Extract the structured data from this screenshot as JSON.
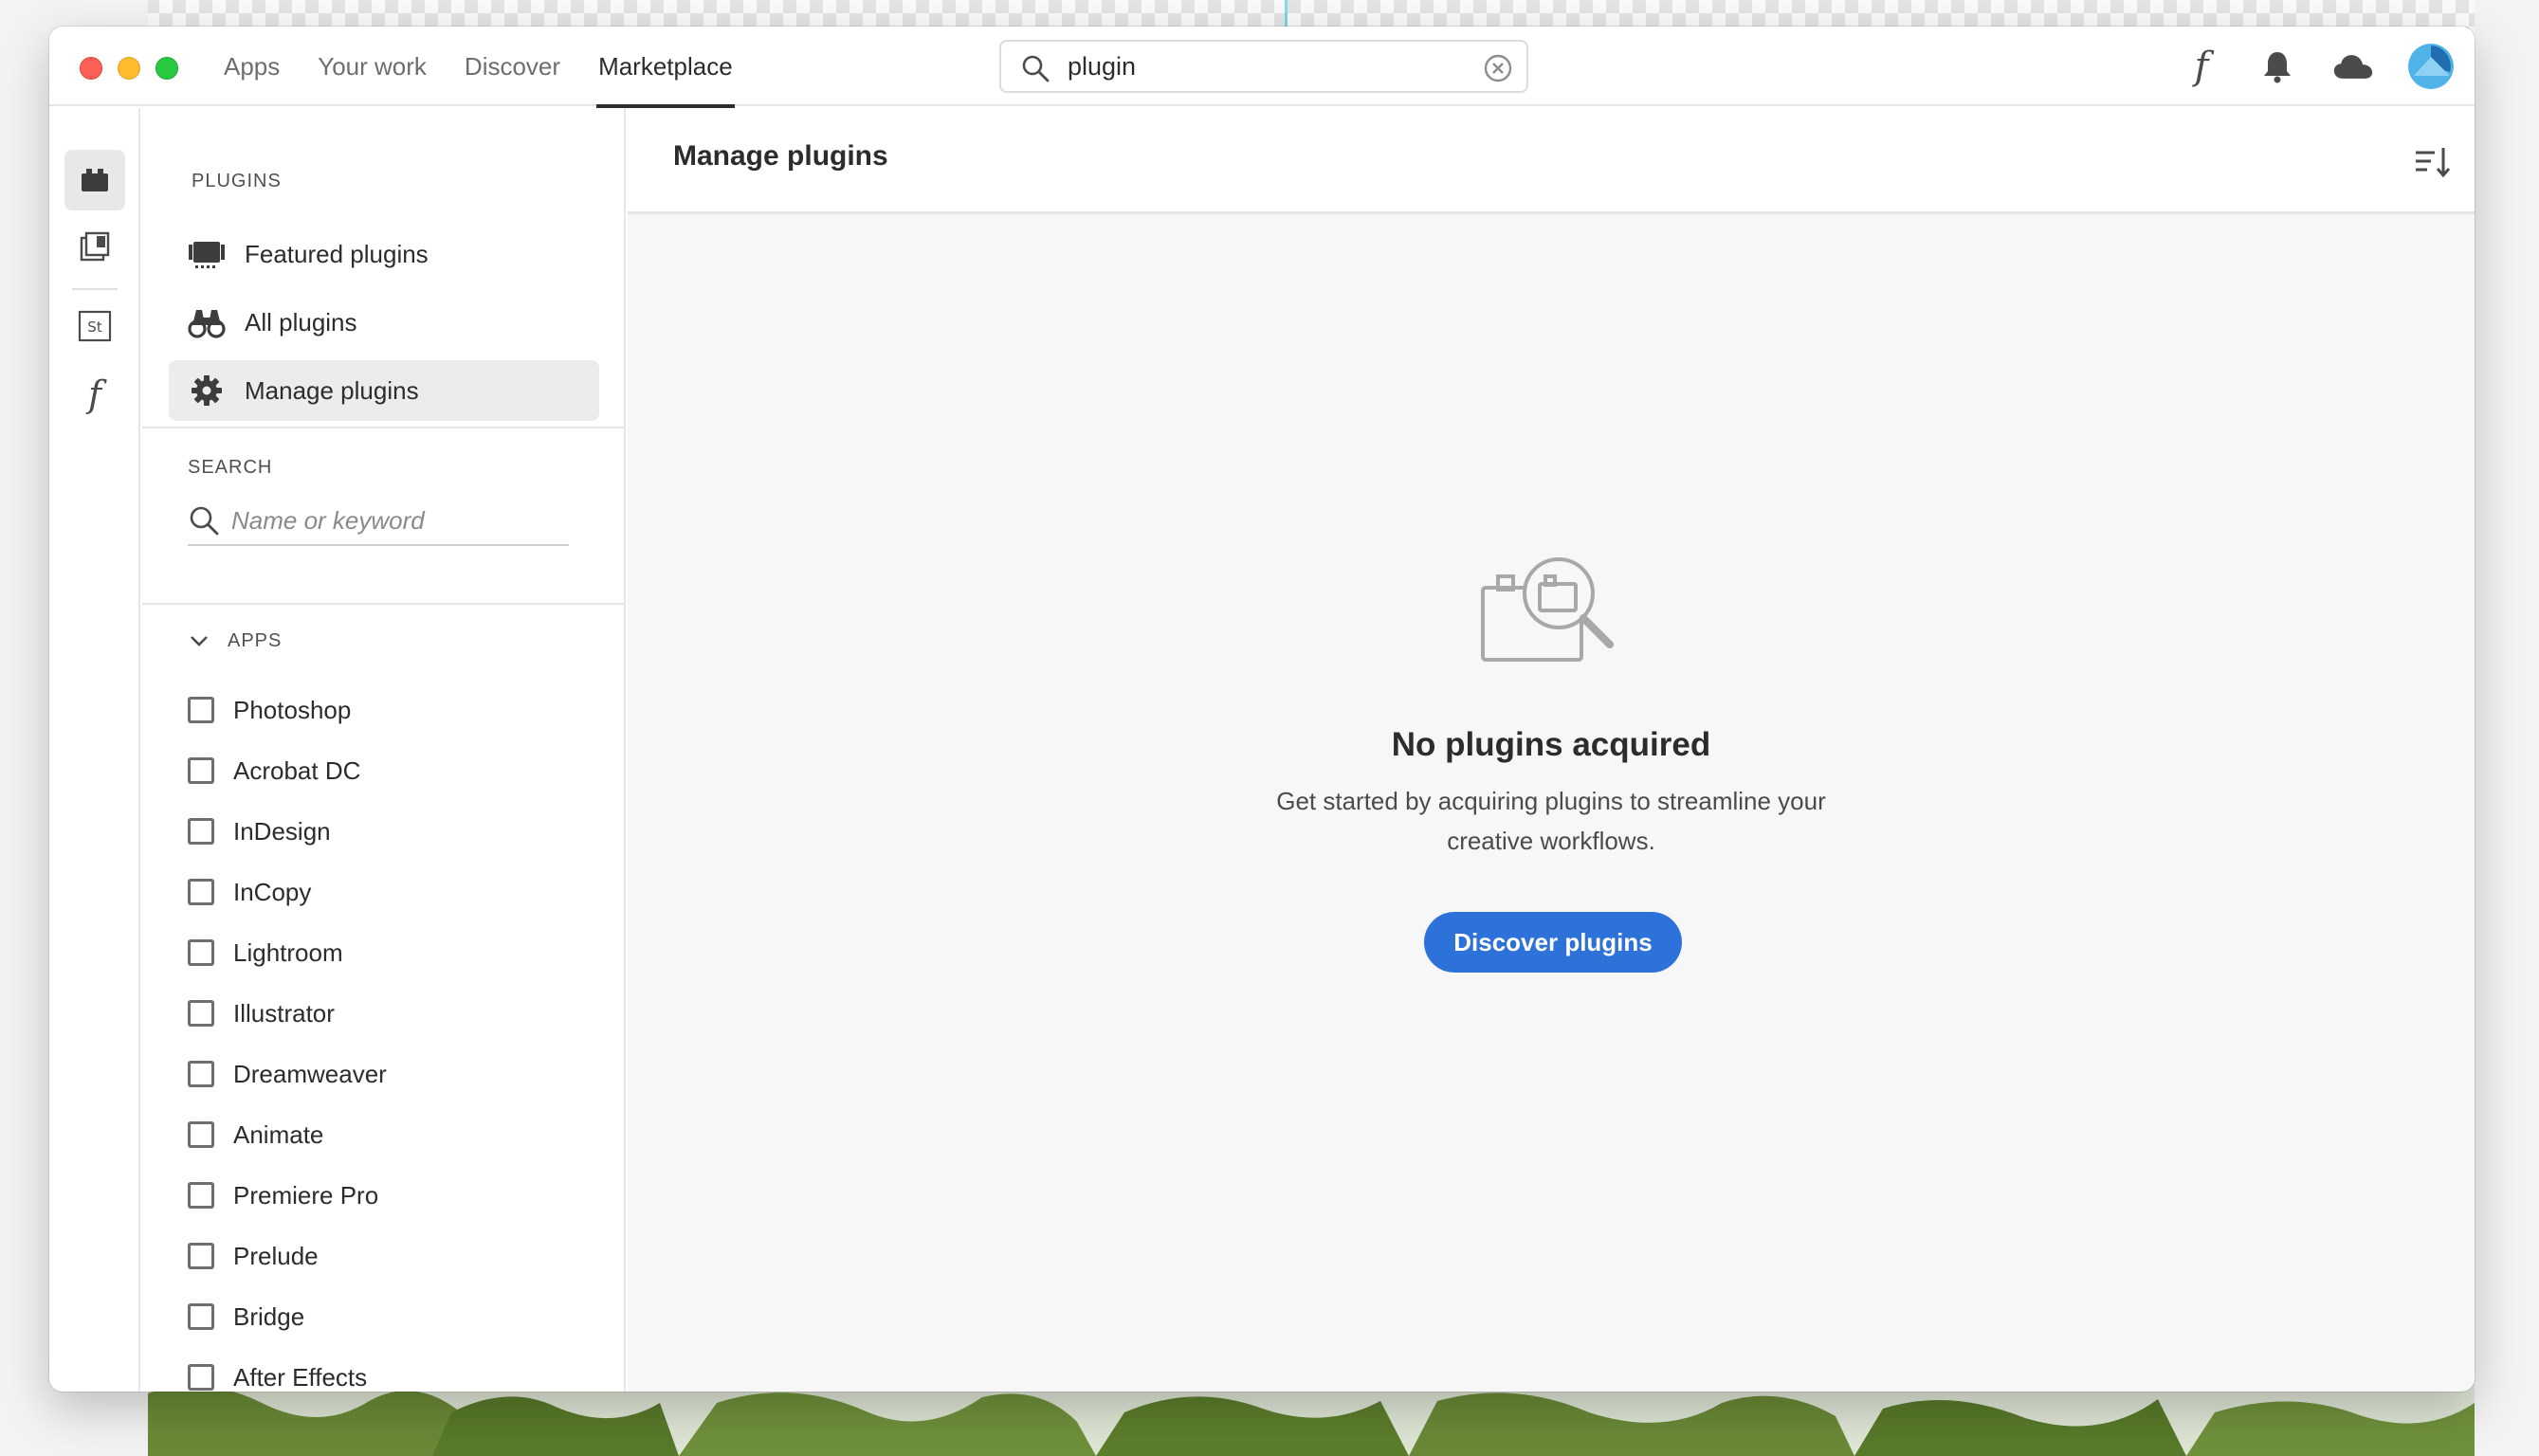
{
  "window": {
    "nav_tabs": [
      "Apps",
      "Your work",
      "Discover",
      "Marketplace"
    ],
    "active_tab": "Marketplace",
    "search": {
      "value": "plugin",
      "icon": "search-icon",
      "clear_icon": "clear-icon"
    },
    "toolbar_icons": [
      "fonts-icon",
      "bell-icon",
      "cloud-icon",
      "avatar"
    ]
  },
  "rail": {
    "items": [
      "plugins-icon",
      "libraries-icon",
      "stock-icon",
      "fonts-icon"
    ],
    "stock_text": "St",
    "fonts_text": "f"
  },
  "sidebar": {
    "plugins_label": "PLUGINS",
    "items": [
      {
        "label": "Featured plugins",
        "icon": "featured-icon"
      },
      {
        "label": "All plugins",
        "icon": "binoculars-icon"
      },
      {
        "label": "Manage plugins",
        "icon": "gear-icon",
        "active": true
      }
    ],
    "search_label": "SEARCH",
    "search_placeholder": "Name or keyword",
    "apps_label": "APPS",
    "apps": [
      "Photoshop",
      "Acrobat DC",
      "InDesign",
      "InCopy",
      "Lightroom",
      "Illustrator",
      "Dreamweaver",
      "Animate",
      "Premiere Pro",
      "Prelude",
      "Bridge",
      "After Effects"
    ]
  },
  "main": {
    "title": "Manage plugins",
    "empty_title": "No plugins acquired",
    "empty_desc": "Get started by acquiring plugins to streamline your creative workflows.",
    "cta": "Discover plugins"
  },
  "colors": {
    "accent": "#2d72d9",
    "avatar": "#4fb3e8"
  }
}
